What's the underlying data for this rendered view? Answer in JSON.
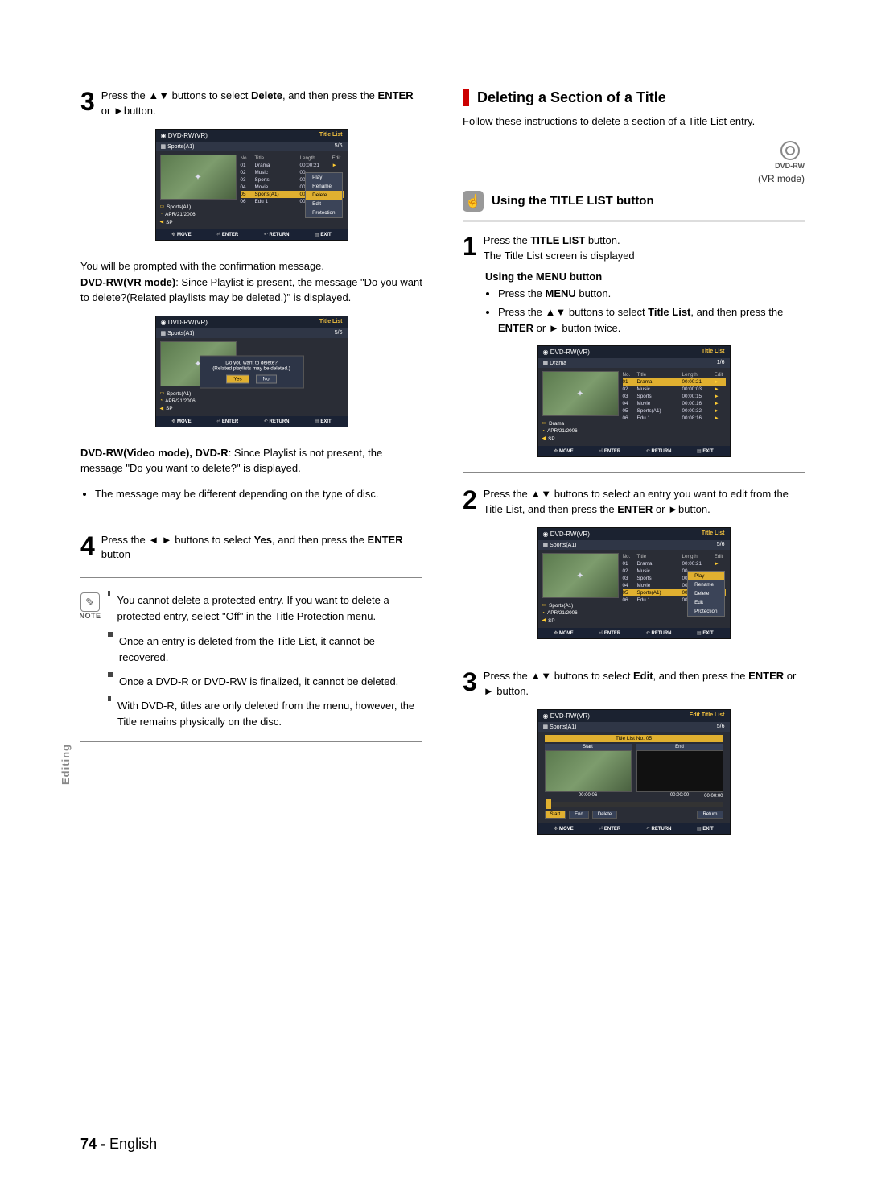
{
  "left": {
    "step3": {
      "text_a": "Press the ",
      "arrows": "▲▼",
      "text_b": " buttons to select ",
      "bold1": "Delete",
      "text_c": ", and then press the ",
      "bold2": "ENTER",
      "text_d": " or ",
      "arrow_r": "►",
      "text_e": "button."
    },
    "prompt_intro": "You will be prompted with the confirmation message.",
    "vr_mode_label": "DVD-RW(VR mode)",
    "vr_mode_text": ":  Since Playlist is present, the message \"Do you want to delete?(Related playlists may be deleted.)\" is displayed.",
    "video_mode_label": "DVD-RW(Video mode), DVD-R",
    "video_mode_text": ":  Since Playlist is not present, the message \"Do you want to delete?\" is displayed.",
    "bullet_msg": "The message may be different depending on the type of disc.",
    "step4": {
      "text_a": "Press the ",
      "arrows": "◄ ►",
      "text_b": " buttons to select ",
      "bold1": "Yes",
      "text_c": ", and then press the ",
      "bold2": "ENTER",
      "text_d": " button"
    },
    "note_label": "NOTE",
    "notes": [
      "You cannot delete a protected entry. If you want to delete a protected entry, select \"Off\" in the Title Protection menu.",
      "Once an entry is deleted from the Title List, it cannot be recovered.",
      "Once a DVD-R or DVD-RW is finalized, it cannot be deleted.",
      "With DVD-R, titles are only deleted from the menu, however, the Title remains physically on the disc."
    ]
  },
  "right": {
    "section_title": "Deleting a Section of a Title",
    "follow": "Follow these instructions to delete a section of a Title List entry.",
    "disc_label": "DVD-RW",
    "disc_mode": "(VR mode)",
    "using_title": "Using the TITLE LIST button",
    "step1": {
      "a": "Press the ",
      "bold": "TITLE LIST",
      "b": " button.",
      "c": "The Title List screen is displayed"
    },
    "menu_heading": "Using the MENU button",
    "menu_b1_a": "Press the ",
    "menu_b1_bold": "MENU",
    "menu_b1_b": " button.",
    "menu_b2_a": "Press the ",
    "menu_b2_arrows": "▲▼",
    "menu_b2_b": "buttons to select ",
    "menu_b2_bold": "Title List",
    "menu_b2_c": ", and then press the ",
    "menu_b2_bold2": "ENTER",
    "menu_b2_d": " or ",
    "menu_b2_arrow": "►",
    "menu_b2_e": "button twice.",
    "step2": {
      "a": "Press the ",
      "arrows": "▲▼",
      "b": "buttons to select an entry you want to edit from the Title List, and then press the ",
      "bold": "ENTER",
      "c": " or ",
      "arrow": "►",
      "d": "button."
    },
    "step3r": {
      "a": "Press the ",
      "arrows": "▲▼",
      "b": "buttons to select ",
      "bold": "Edit",
      "c": ", and then press the ",
      "bold2": "ENTER",
      "d": " or ",
      "arrow": "►",
      "e": " button."
    }
  },
  "osd": {
    "disc": "DVD-RW(VR)",
    "title_list": "Title List",
    "edit_list": "Edit Title List",
    "sports": "Sports(A1)",
    "drama": "Drama",
    "five_six": "5/6",
    "one_six": "1/6",
    "headers": {
      "no": "No.",
      "title": "Title",
      "length": "Length",
      "edit": "Edit"
    },
    "rows": [
      {
        "no": "01",
        "title": "Drama",
        "len": "00:00:21"
      },
      {
        "no": "02",
        "title": "Music",
        "len": "00:00:03"
      },
      {
        "no": "03",
        "title": "Sports",
        "len": "00:00:15"
      },
      {
        "no": "04",
        "title": "Movie",
        "len": "00:00:16"
      },
      {
        "no": "05",
        "title": "Sports(A1)",
        "len": "00:00:32"
      },
      {
        "no": "06",
        "title": "Edu 1",
        "len": "00:08:16"
      }
    ],
    "meta_date": "APR/21/2006",
    "meta_sp": "SP",
    "ctx": {
      "play": "Play",
      "rename": "Rename",
      "delete": "Delete",
      "edit": "Edit",
      "protection": "Protection"
    },
    "dialog_q": "Do you want to delete?",
    "dialog_sub": "(Related playlists may be deleted.)",
    "yes": "Yes",
    "no": "No",
    "nav": {
      "move": "MOVE",
      "enter": "ENTER",
      "return": "RETURN",
      "exit": "EXIT"
    },
    "edit_panel": {
      "title_no": "Title List No. 05",
      "start": "Start",
      "end": "End",
      "t1": "00:00:06",
      "t2": "00:00:00",
      "total": "00:00:00",
      "delete": "Delete",
      "return": "Return"
    }
  },
  "side_tab": "Editing",
  "page_number": "74 -",
  "page_lang": "English"
}
